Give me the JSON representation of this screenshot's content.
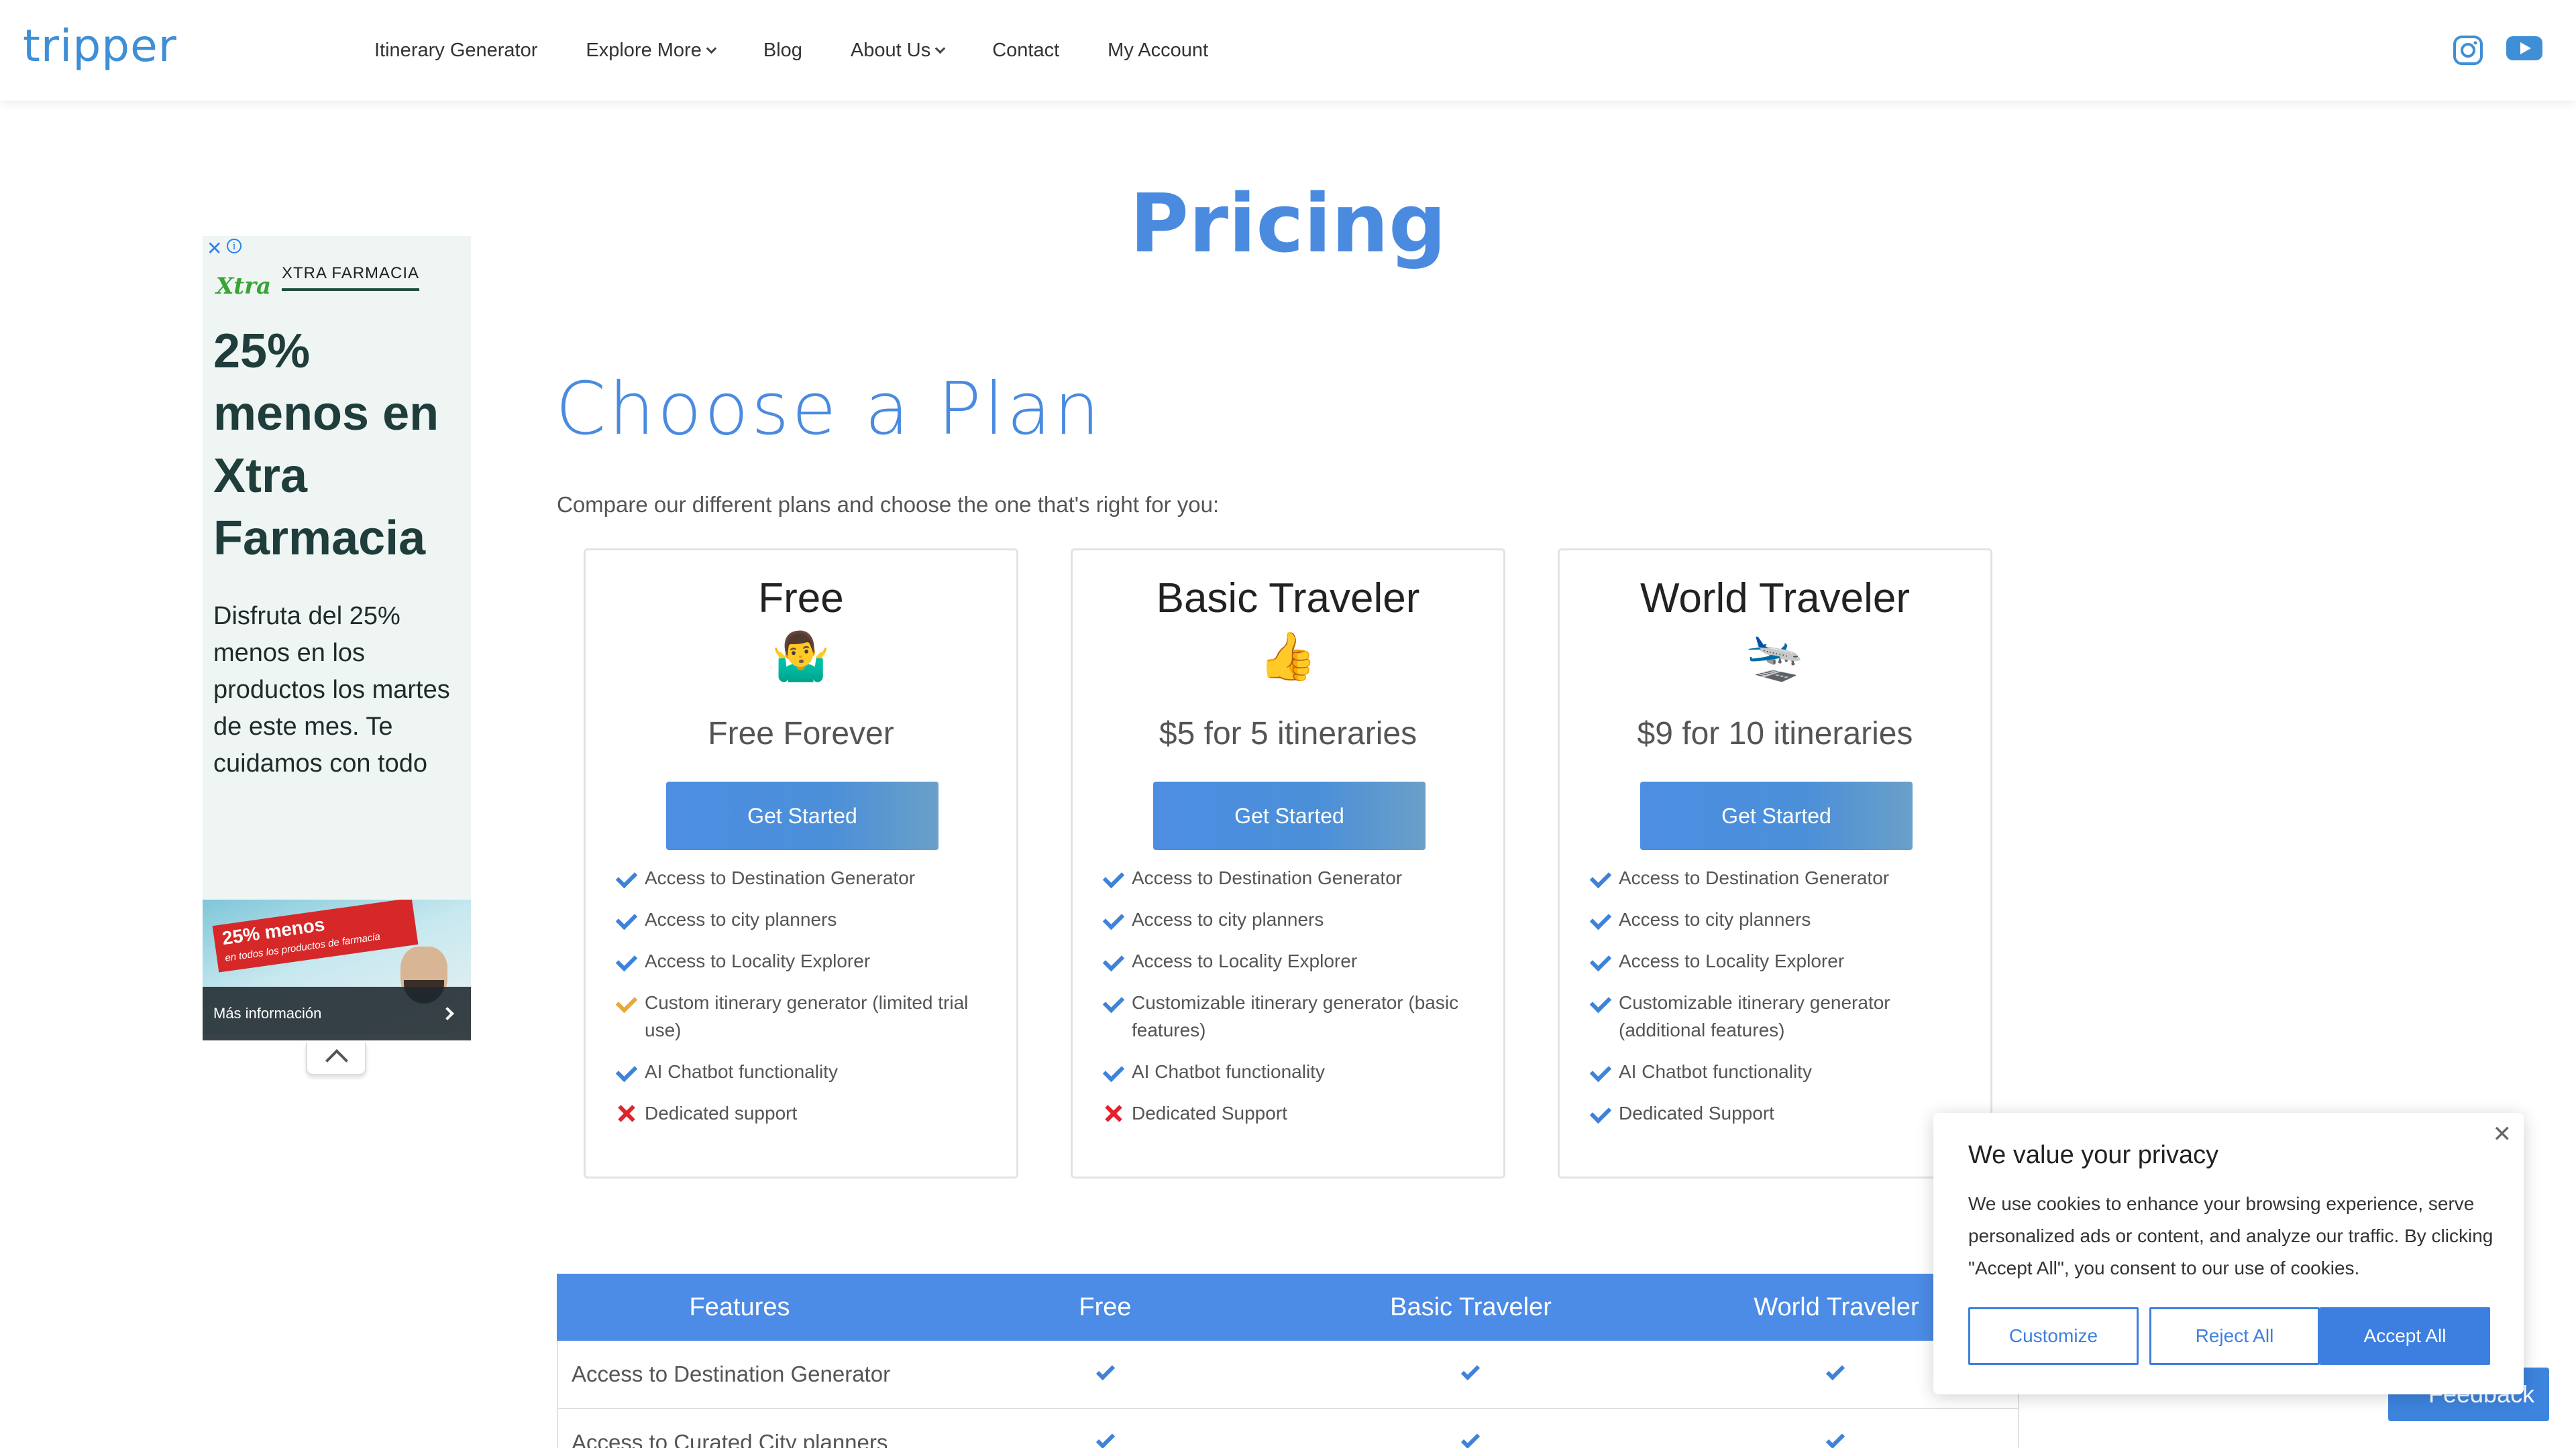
{
  "header": {
    "logo": "tripper",
    "nav": [
      {
        "label": "Itinerary Generator",
        "has_dropdown": false
      },
      {
        "label": "Explore More",
        "has_dropdown": true
      },
      {
        "label": "Blog",
        "has_dropdown": false
      },
      {
        "label": "About Us",
        "has_dropdown": true
      },
      {
        "label": "Contact",
        "has_dropdown": false
      },
      {
        "label": "My Account",
        "has_dropdown": false
      }
    ],
    "social": [
      "instagram-icon",
      "youtube-icon"
    ]
  },
  "ad": {
    "brand": "XTRA FARMACIA",
    "brand_logo": "Xtra",
    "headline": "25% menos en Xtra Farmacia",
    "description": "Disfruta del 25% menos en los productos los martes de este mes. Te cuidamos con todo",
    "image_promo": "25% menos",
    "image_promo_sub": "en todos los productos de farmacia",
    "cta": "Más información"
  },
  "main": {
    "title": "Pricing",
    "subtitle": "Choose a Plan",
    "intro": "Compare our different plans and choose the one that's right for you:"
  },
  "plans": [
    {
      "name": "Free",
      "emoji": "🤷‍♂️",
      "price": "Free Forever",
      "button": "Get Started",
      "features": [
        {
          "text": "Access to Destination Generator",
          "status": "check"
        },
        {
          "text": "Access to city planners",
          "status": "check"
        },
        {
          "text": "Access to Locality Explorer",
          "status": "check"
        },
        {
          "text": "Custom itinerary generator (limited trial use)",
          "status": "partial"
        },
        {
          "text": "AI Chatbot functionality",
          "status": "check"
        },
        {
          "text": "Dedicated support",
          "status": "cross"
        }
      ]
    },
    {
      "name": "Basic Traveler",
      "emoji": "👍",
      "price": "$5 for 5 itineraries",
      "button": "Get Started",
      "features": [
        {
          "text": "Access to Destination Generator",
          "status": "check"
        },
        {
          "text": "Access to city planners",
          "status": "check"
        },
        {
          "text": "Access to Locality Explorer",
          "status": "check"
        },
        {
          "text": "Customizable itinerary generator (basic features)",
          "status": "check"
        },
        {
          "text": "AI Chatbot functionality",
          "status": "check"
        },
        {
          "text": "Dedicated Support",
          "status": "cross"
        }
      ]
    },
    {
      "name": "World Traveler",
      "emoji": "🛬",
      "price": "$9 for 10 itineraries",
      "button": "Get Started",
      "features": [
        {
          "text": "Access to Destination Generator",
          "status": "check"
        },
        {
          "text": "Access to city planners",
          "status": "check"
        },
        {
          "text": "Access to Locality Explorer",
          "status": "check"
        },
        {
          "text": "Customizable itinerary generator (additional features)",
          "status": "check"
        },
        {
          "text": "AI Chatbot functionality",
          "status": "check"
        },
        {
          "text": "Dedicated Support",
          "status": "check"
        }
      ]
    }
  ],
  "compare_table": {
    "headers": [
      "Features",
      "Free",
      "Basic Traveler",
      "World Traveler"
    ],
    "rows": [
      {
        "label": "Access to Destination Generator",
        "values": [
          true,
          true,
          true
        ]
      },
      {
        "label": "Access to Curated City planners",
        "values": [
          true,
          true,
          true
        ]
      }
    ]
  },
  "feedback": {
    "label": "Feedback"
  },
  "cookie": {
    "title": "We value your privacy",
    "text": "We use cookies to enhance your browsing experience, serve personalized ads or content, and analyze our traffic. By clicking \"Accept All\", you consent to our use of cookies.",
    "buttons": {
      "customize": "Customize",
      "reject": "Reject All",
      "accept": "Accept All"
    }
  },
  "colors": {
    "brand_blue": "#4a8be0",
    "button_blue": "#4d8ee3",
    "check_blue": "#3f83d9",
    "partial_orange": "#e8a93a",
    "cross_red": "#e0232c",
    "logo_green": "#6cc24a"
  }
}
